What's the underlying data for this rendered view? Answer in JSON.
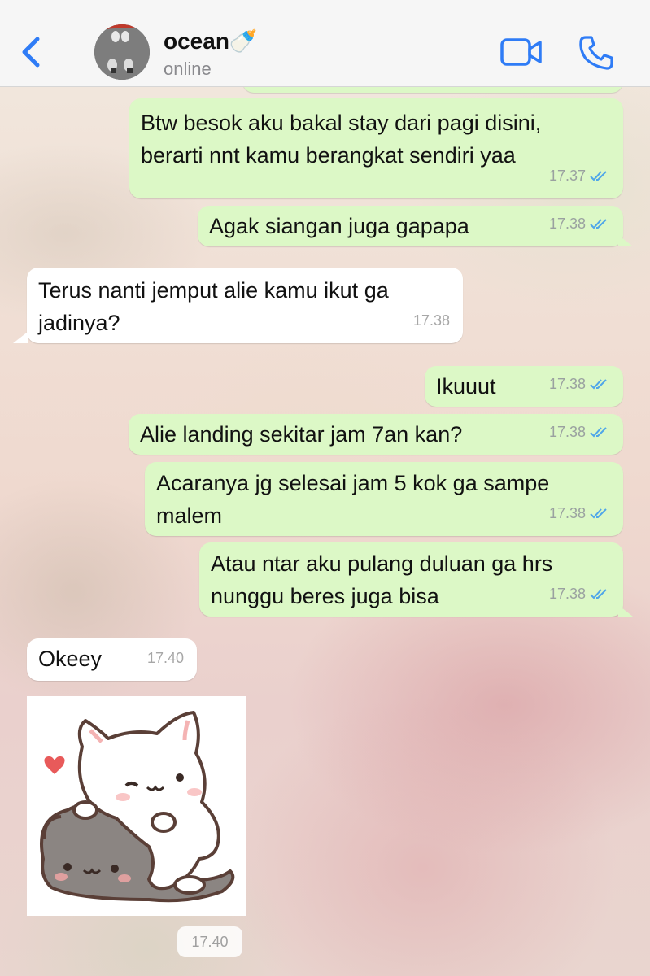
{
  "header": {
    "contact_name": "ocean🍼",
    "status": "online"
  },
  "icons": {
    "back": "chevron-left-icon",
    "video": "video-camera-icon",
    "call": "phone-icon",
    "read_receipt": "double-check-icon",
    "sticker": "cat-sticker"
  },
  "colors": {
    "accent": "#2f7cf6",
    "outgoing_bubble": "#dcf8c6",
    "incoming_bubble": "#ffffff",
    "read_ticks": "#4fa6e9"
  },
  "messages": [
    {
      "text": "Btw besok aku bakal stay dari pagi disini,\nberarti nnt kamu berangkat sendiri yaa",
      "time": "17.37",
      "direction": "out"
    },
    {
      "text": "Agak siangan juga gapapa",
      "time": "17.38",
      "direction": "out"
    },
    {
      "text": "Terus nanti jemput alie kamu ikut ga\njadinya?",
      "time": "17.38",
      "direction": "in"
    },
    {
      "text": "Ikuuut",
      "time": "17.38",
      "direction": "out"
    },
    {
      "text": "Alie landing sekitar jam 7an kan?",
      "time": "17.38",
      "direction": "out"
    },
    {
      "text": "Acaranya jg selesai jam 5 kok ga sampe\nmalem",
      "time": "17.38",
      "direction": "out"
    },
    {
      "text": "Atau ntar aku pulang duluan ga hrs\nnunggu beres juga bisa",
      "time": "17.38",
      "direction": "out"
    },
    {
      "text": "Okeey",
      "time": "17.40",
      "direction": "in"
    }
  ],
  "sticker_time": "17.40"
}
